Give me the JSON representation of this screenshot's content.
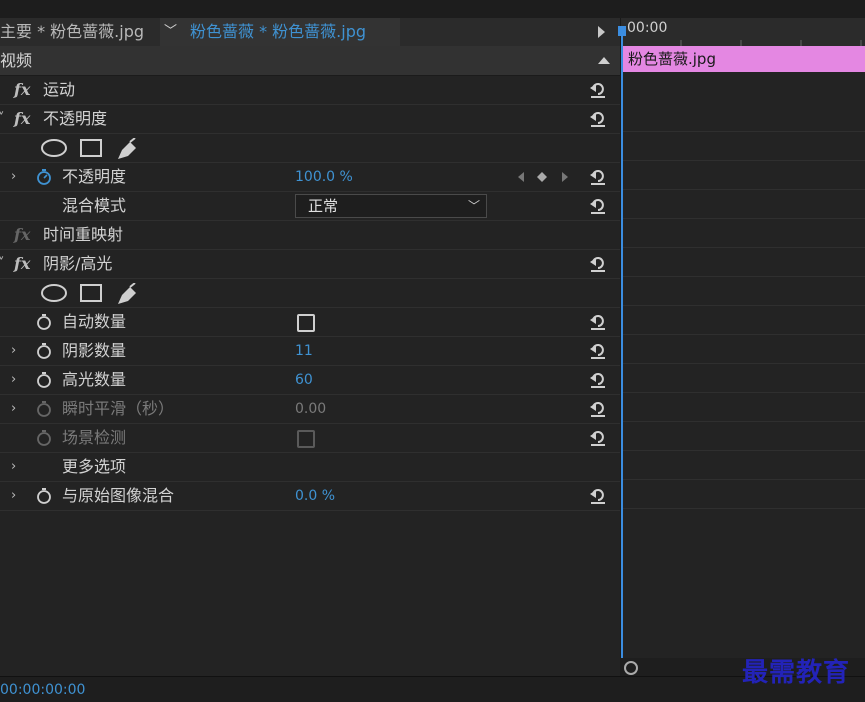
{
  "tabs": {
    "inactive_label": "主要 * 粉色蔷薇.jpg",
    "active_label": "粉色蔷薇 * 粉色蔷薇.jpg"
  },
  "panel": {
    "section_title": "视频"
  },
  "effects": {
    "motion": "运动",
    "opacity": "不透明度",
    "opacity_param": "不透明度",
    "opacity_value": "100.0 %",
    "blend_mode_label": "混合模式",
    "blend_mode_value": "正常",
    "time_remap": "时间重映射",
    "shadow_highlight": "阴影/高光",
    "auto_amount": "自动数量",
    "shadow_amount": "阴影数量",
    "shadow_amount_value": "11",
    "highlight_amount": "高光数量",
    "highlight_amount_value": "60",
    "temporal_smoothing": "瞬时平滑（秒）",
    "temporal_smoothing_value": "0.00",
    "scene_detect": "场景检测",
    "more_options": "更多选项",
    "blend_with_original": "与原始图像混合",
    "blend_with_original_value": "0.0 %"
  },
  "timeline": {
    "ruler_time": "00:00",
    "clip_name": "粉色蔷薇.jpg"
  },
  "footer": {
    "timecode": "00:00:00:00"
  },
  "watermark": "最需教育",
  "colors": {
    "accent_blue": "#3f92d2",
    "clip_pink": "#e487e2",
    "panel_bg": "#232323"
  }
}
